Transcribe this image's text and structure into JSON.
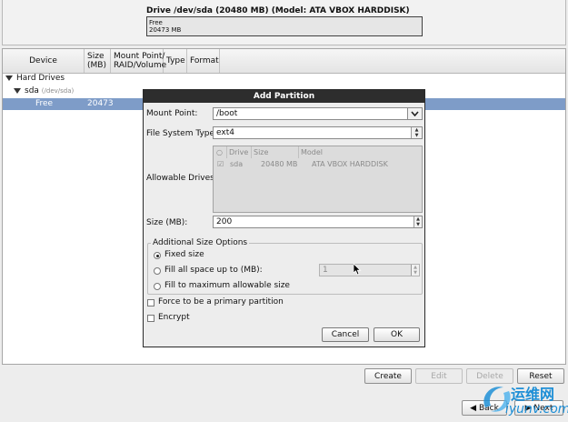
{
  "drive": {
    "title": "Drive /dev/sda (20480 MB) (Model: ATA VBOX HARDDISK)",
    "bar_line1": "Free",
    "bar_line2": "20473 MB"
  },
  "table": {
    "columns": [
      "Device",
      "Size (MB)",
      "Mount Point/ RAID/Volume",
      "Type",
      "Format"
    ],
    "rows": {
      "hard_drives": "Hard Drives",
      "sda": "sda",
      "sda_path": "(/dev/sda)",
      "free": "Free",
      "free_size": "20473"
    }
  },
  "buttons": {
    "create": "Create",
    "edit": "Edit",
    "delete": "Delete",
    "reset": "Reset",
    "back": "Back",
    "next": "Next"
  },
  "dialog": {
    "title": "Add Partition",
    "mount_point_label": "Mount Point:",
    "mount_point_value": "/boot",
    "fs_type_label": "File System Type:",
    "fs_type_value": "ext4",
    "allowable_drives_label": "Allowable Drives:",
    "drives_columns": [
      "Drive",
      "Size",
      "Model"
    ],
    "drives_row": {
      "drive": "sda",
      "size": "20480 MB",
      "model": "ATA VBOX HARDDISK"
    },
    "size_label": "Size (MB):",
    "size_value": "200",
    "additional_size_title": "Additional Size Options",
    "fixed_size": "Fixed size",
    "fill_up_to": "Fill all space up to (MB):",
    "fill_up_to_value": "1",
    "fill_max": "Fill to maximum allowable size",
    "primary_partition": "Force to be a primary partition",
    "encrypt": "Encrypt",
    "cancel": "Cancel",
    "ok": "OK"
  },
  "watermark": {
    "cn": "运维网",
    "en": "iyunv.com"
  },
  "colors": {
    "selection": "#7e9cc8",
    "title_bar": "#2d2d2d",
    "watermark": "#1f8fd6"
  }
}
